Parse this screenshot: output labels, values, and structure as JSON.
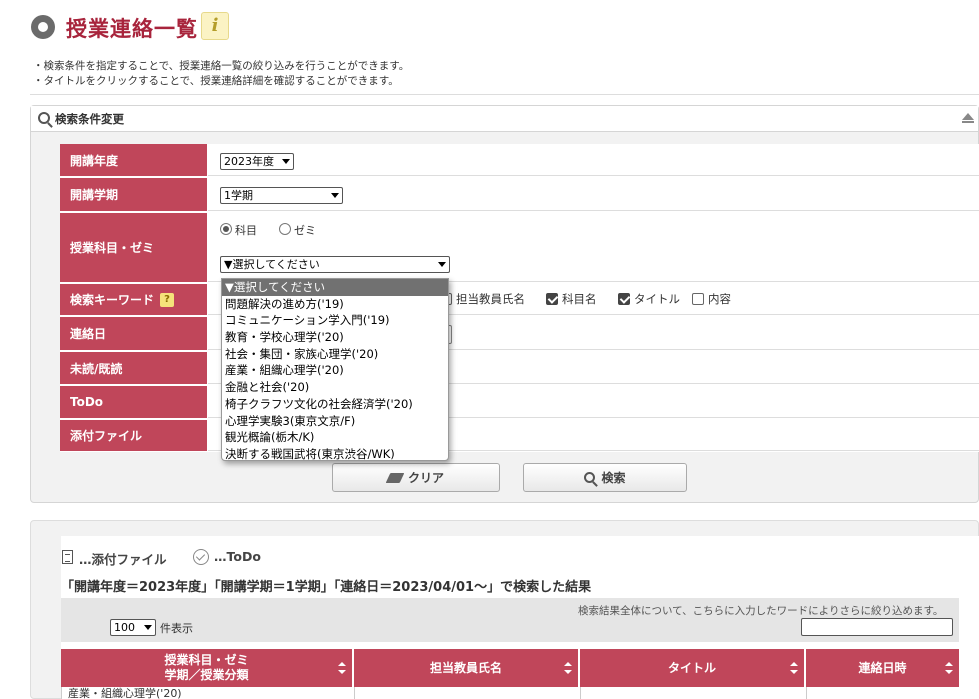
{
  "header": {
    "title": "授業連絡一覧",
    "info_icon_glyph": "i"
  },
  "descriptions": [
    "・検索条件を指定することで、授業連絡一覧の絞り込みを行うことができます。",
    "・タイトルをクリックすることで、授業連絡詳細を確認することができます。"
  ],
  "search_panel": {
    "title": "検索条件変更",
    "rows": {
      "year": {
        "label": "開講年度",
        "value": "2023年度"
      },
      "term": {
        "label": "開講学期",
        "value": "1学期"
      },
      "subject": {
        "label": "授業科目・ゼミ",
        "radio_subject": "科目",
        "radio_seminar": "ゼミ",
        "selected_radio": "科目",
        "select_value": "▼選択してください"
      },
      "keyword": {
        "label": "検索キーワード",
        "help_icon": "?",
        "options": [
          {
            "label": "担当教員氏名",
            "checked": false
          },
          {
            "label": "科目名",
            "checked": true
          },
          {
            "label": "タイトル",
            "checked": true
          },
          {
            "label": "内容",
            "checked": false
          }
        ]
      },
      "contact_date": {
        "label": "連絡日"
      },
      "read_status": {
        "label": "未読/既読"
      },
      "todo": {
        "label": "ToDo"
      },
      "attachment": {
        "label": "添付ファイル"
      }
    },
    "dropdown_options": [
      "▼選択してください",
      "問題解決の進め方('19)",
      "コミュニケーション学入門('19)",
      "教育・学校心理学('20)",
      "社会・集団・家族心理学('20)",
      "産業・組織心理学('20)",
      "金融と社会('20)",
      "椅子クラフツ文化の社会経済学('20)",
      "心理学実験3(東京文京/F)",
      "観光概論(栃木/K)",
      "決断する戦国武将(東京渋谷/WK)"
    ],
    "clear_button": "クリア",
    "search_button": "検索"
  },
  "results": {
    "legend_attachment": "…添付ファイル",
    "legend_todo": "…ToDo",
    "condition": "「開講年度＝2023年度」「開講学期＝1学期」「連絡日＝2023/04/01～」で検索した結果",
    "filter_note": "検索結果全体について、こちらに入力したワードによりさらに絞り込めます。",
    "per_page_value": "100",
    "per_page_label": "件表示",
    "columns": [
      {
        "line1": "授業科目・ゼミ",
        "line2": "学期／授業分類"
      },
      {
        "line1": "担当教員氏名",
        "line2": ""
      },
      {
        "line1": "タイトル",
        "line2": ""
      },
      {
        "line1": "連絡日時",
        "line2": ""
      }
    ],
    "first_row_subject": "産業・組織心理学('20)"
  },
  "colors": {
    "accent": "#c0465a",
    "title": "#a8243c"
  }
}
